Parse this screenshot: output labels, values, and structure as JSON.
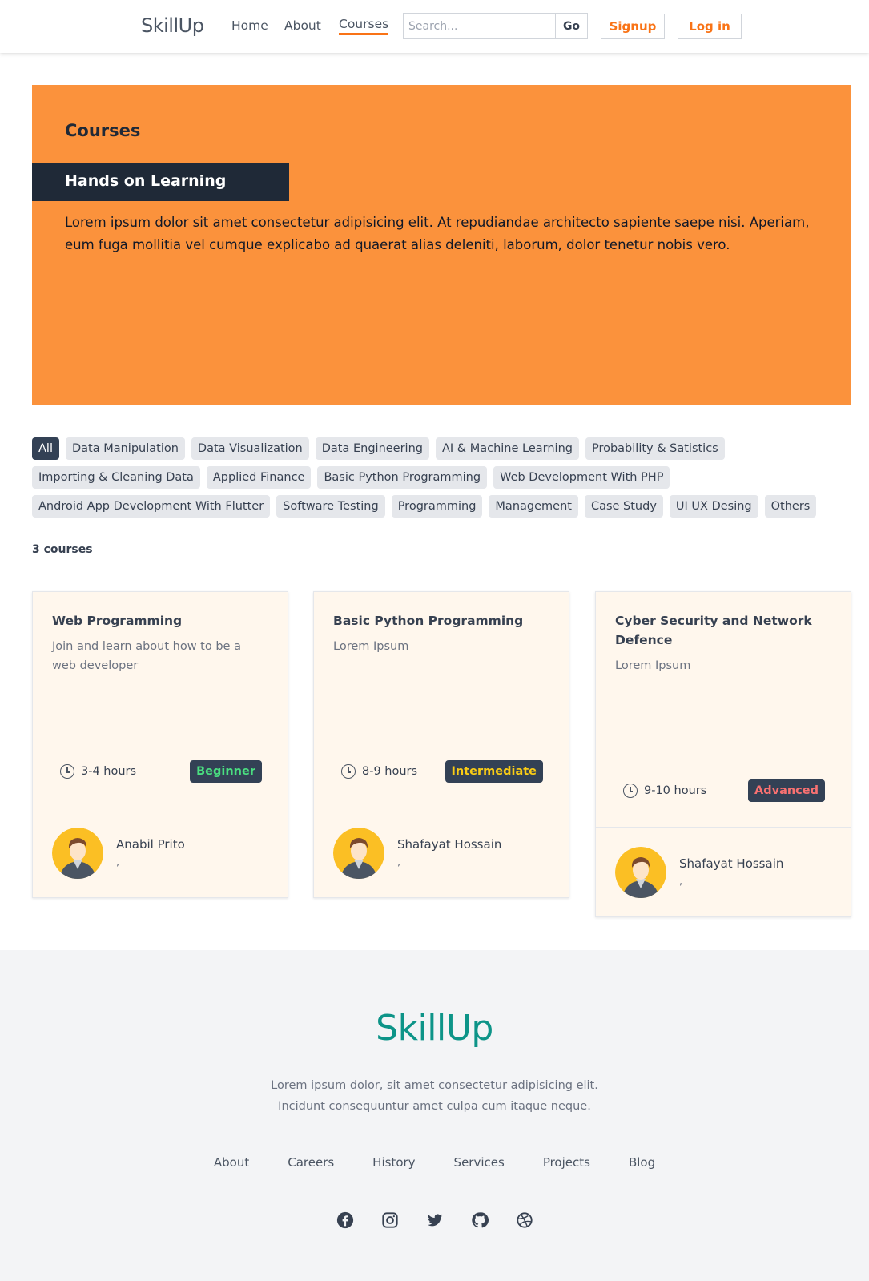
{
  "header": {
    "brand": "SkillUp",
    "nav": [
      "Home",
      "About",
      "Courses"
    ],
    "active_nav": "Courses",
    "search_placeholder": "Search...",
    "search_button": "Go",
    "signup": "Signup",
    "login": "Log in",
    "accent_color": "#f97316"
  },
  "hero": {
    "title": "Courses",
    "subtitle": "Hands on Learning",
    "text": "Lorem ipsum dolor sit amet consectetur adipisicing elit. At repudiandae architecto sapiente saepe nisi. Aperiam, eum fuga mollitia vel cumque explicabo ad quaerat alias deleniti, laborum, dolor tenetur nobis vero.",
    "background": "#fb923c"
  },
  "categories": [
    [
      "All",
      "Data Manipulation",
      "Data Visualization",
      "Data Engineering",
      "AI & Machine Learning",
      "Probability & Satistics"
    ],
    [
      "Importing & Cleaning Data",
      "Applied Finance",
      "Basic Python Programming",
      "Web Development With PHP"
    ],
    [
      "Android App Development With Flutter",
      "Software Testing",
      "Programming",
      "Management",
      "Case Study",
      "UI UX Desing",
      "Others"
    ]
  ],
  "active_category": "All",
  "course_count": "3 courses",
  "courses": [
    {
      "title": "Web Programming",
      "description": "Join and learn about how to be a web developer",
      "duration": "3-4 hours",
      "level": "Beginner",
      "level_color": "#4ade80",
      "author": "Anabil Prito",
      "author_sub": ","
    },
    {
      "title": "Basic Python Programming",
      "description": "Lorem Ipsum",
      "duration": "8-9 hours",
      "level": "Intermediate",
      "level_color": "#facc15",
      "author": "Shafayat Hossain",
      "author_sub": ","
    },
    {
      "title": "Cyber Security and Network Defence",
      "description": "Lorem Ipsum",
      "duration": "9-10 hours",
      "level": "Advanced",
      "level_color": "#f87171",
      "author": "Shafayat Hossain",
      "author_sub": ","
    }
  ],
  "footer": {
    "brand": "SkillUp",
    "text_line1": "Lorem ipsum dolor, sit amet consectetur adipisicing elit.",
    "text_line2": "Incidunt consequuntur amet culpa cum itaque neque.",
    "links": [
      "About",
      "Careers",
      "History",
      "Services",
      "Projects",
      "Blog"
    ],
    "social_icons": [
      "facebook-icon",
      "instagram-icon",
      "twitter-icon",
      "github-icon",
      "dribbble-icon"
    ],
    "brand_color": "#0d9488"
  }
}
